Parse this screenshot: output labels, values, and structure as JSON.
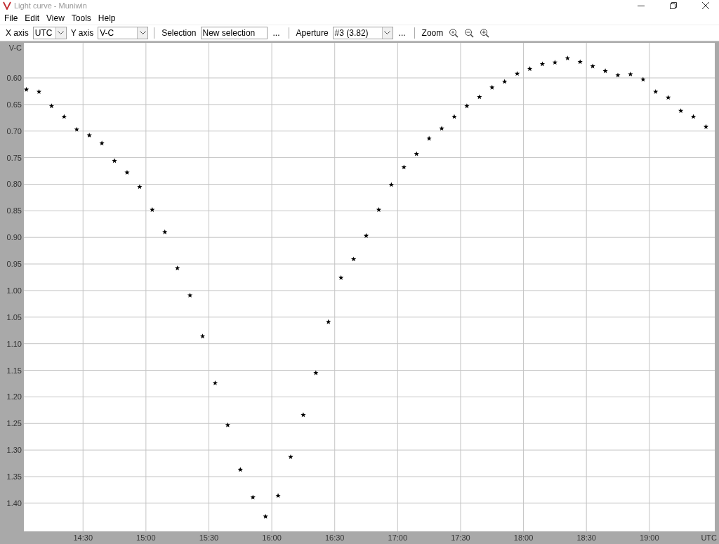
{
  "window": {
    "title": "Light curve - Muniwin"
  },
  "menu": [
    "File",
    "Edit",
    "View",
    "Tools",
    "Help"
  ],
  "toolbar": {
    "x_axis": {
      "label": "X axis",
      "value": "UTC"
    },
    "y_axis": {
      "label": "Y axis",
      "value": "V-C"
    },
    "selection": {
      "label": "Selection",
      "value": "New selection",
      "more": "..."
    },
    "aperture": {
      "label": "Aperture",
      "value": "#3 (3.82)",
      "more": "..."
    },
    "zoom": {
      "label": "Zoom"
    }
  },
  "chart": {
    "chart_data": {
      "type": "scatter",
      "grid": true,
      "xlabel": "UTC",
      "ylabel": "V-C",
      "xlim": [
        14.03,
        19.52
      ],
      "ylim": [
        1.453,
        0.534
      ],
      "xticks": [
        {
          "value": 14.5,
          "label": "14:30"
        },
        {
          "value": 15,
          "label": "15:00"
        },
        {
          "value": 15.5,
          "label": "15:30"
        },
        {
          "value": 16,
          "label": "16:00"
        },
        {
          "value": 16.5,
          "label": "16:30"
        },
        {
          "value": 17,
          "label": "17:00"
        },
        {
          "value": 17.5,
          "label": "17:30"
        },
        {
          "value": 18,
          "label": "18:00"
        },
        {
          "value": 18.5,
          "label": "18:30"
        },
        {
          "value": 19,
          "label": "19:00"
        }
      ],
      "yticks": [
        {
          "value": 0.6,
          "label": "0.60"
        },
        {
          "value": 0.65,
          "label": "0.65"
        },
        {
          "value": 0.7,
          "label": "0.70"
        },
        {
          "value": 0.75,
          "label": "0.75"
        },
        {
          "value": 0.8,
          "label": "0.80"
        },
        {
          "value": 0.85,
          "label": "0.85"
        },
        {
          "value": 0.9,
          "label": "0.90"
        },
        {
          "value": 0.95,
          "label": "0.95"
        },
        {
          "value": 1,
          "label": "1.00"
        },
        {
          "value": 1.05,
          "label": "1.05"
        },
        {
          "value": 1.1,
          "label": "1.10"
        },
        {
          "value": 1.15,
          "label": "1.15"
        },
        {
          "value": 1.2,
          "label": "1.20"
        },
        {
          "value": 1.25,
          "label": "1.25"
        },
        {
          "value": 1.3,
          "label": "1.30"
        },
        {
          "value": 1.35,
          "label": "1.35"
        },
        {
          "value": 1.4,
          "label": "1.40"
        }
      ],
      "x": [
        14.05,
        14.15,
        14.25,
        14.35,
        14.45,
        14.55,
        14.65,
        14.75,
        14.85,
        14.95,
        15.05,
        15.15,
        15.25,
        15.35,
        15.45,
        15.55,
        15.65,
        15.75,
        15.85,
        15.95,
        16.05,
        16.15,
        16.25,
        16.35,
        16.45,
        16.55,
        16.65,
        16.75,
        16.85,
        16.95,
        17.05,
        17.15,
        17.25,
        17.35,
        17.45,
        17.55,
        17.65,
        17.75,
        17.85,
        17.95,
        18.05,
        18.15,
        18.25,
        18.35,
        18.45,
        18.55,
        18.65,
        18.75,
        18.85,
        18.95,
        19.05,
        19.15,
        19.25,
        19.35,
        19.45
      ],
      "series": [
        {
          "color": "#000000",
          "values": [
            0.622,
            0.626,
            0.653,
            0.673,
            0.697,
            0.708,
            0.723,
            0.756,
            0.778,
            0.805,
            0.848,
            0.89,
            0.958,
            1.009,
            1.086,
            1.174,
            1.253,
            1.337,
            1.389,
            1.425,
            1.386,
            1.313,
            1.234,
            1.155,
            1.059,
            0.976,
            0.941,
            0.897,
            0.848,
            0.801,
            0.768,
            0.743,
            0.714,
            0.695,
            0.673,
            0.653,
            0.636,
            0.618,
            0.607,
            0.592,
            0.583,
            0.574,
            0.571,
            0.563,
            0.57,
            0.578,
            0.587,
            0.595,
            0.593,
            0.603,
            0.626,
            0.637,
            0.662,
            0.673,
            0.692
          ]
        }
      ]
    }
  }
}
